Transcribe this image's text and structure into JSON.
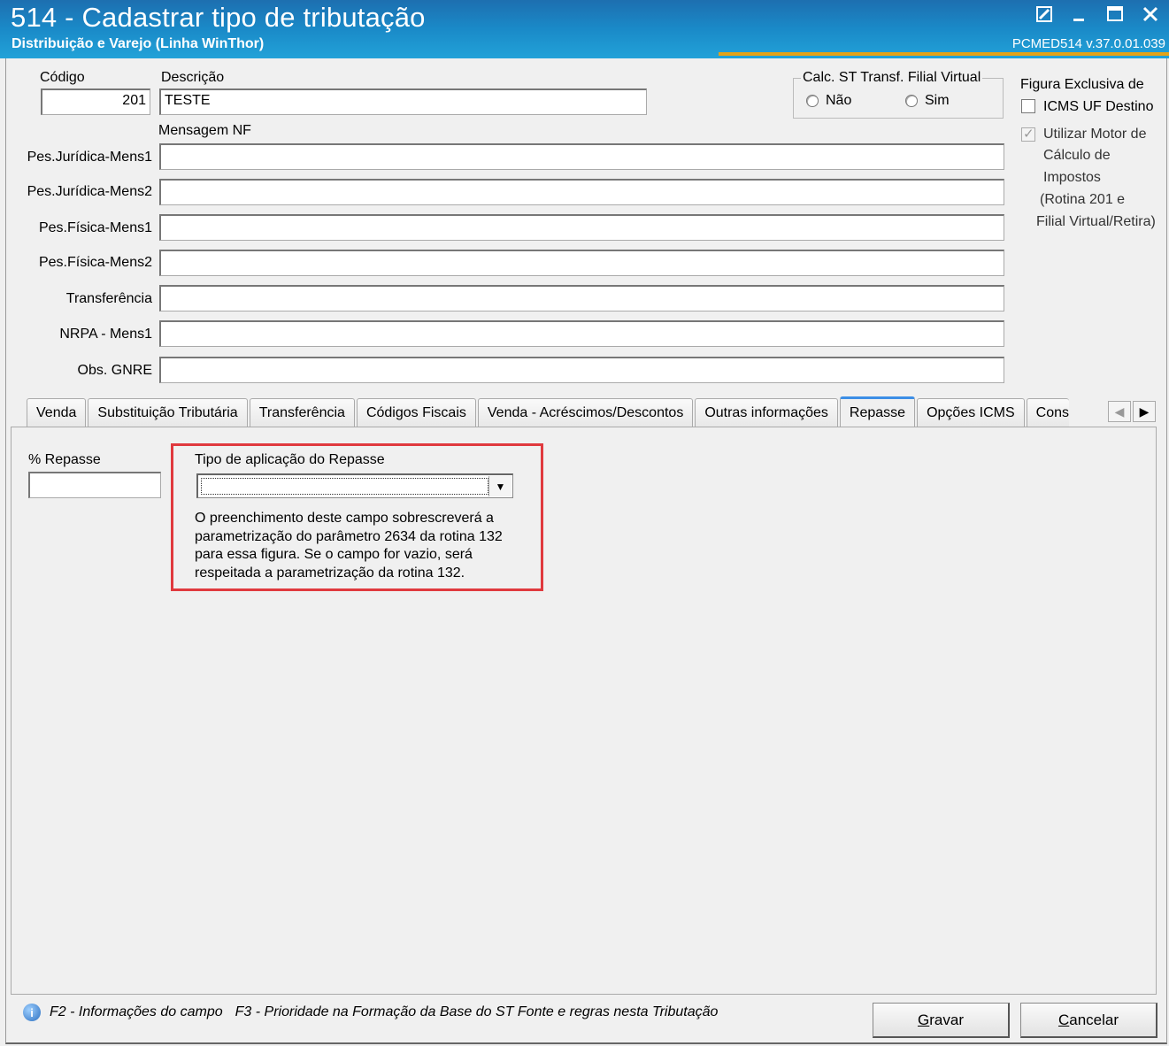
{
  "window": {
    "title": "514 - Cadastrar tipo de tributação",
    "subtitle": "Distribuição e Varejo (Linha WinThor)",
    "version": "PCMED514  v.37.0.01.039"
  },
  "form": {
    "codigo_label": "Código",
    "codigo_value": "201",
    "descricao_label": "Descrição",
    "descricao_value": "TESTE",
    "mensagem_nf_label": "Mensagem NF",
    "rows": [
      {
        "label": "Pes.Jurídica-Mens1",
        "value": ""
      },
      {
        "label": "Pes.Jurídica-Mens2",
        "value": ""
      },
      {
        "label": "Pes.Física-Mens1",
        "value": ""
      },
      {
        "label": "Pes.Física-Mens2",
        "value": ""
      },
      {
        "label": "Transferência",
        "value": ""
      },
      {
        "label": "NRPA - Mens1",
        "value": ""
      },
      {
        "label": "Obs. GNRE",
        "value": ""
      }
    ]
  },
  "calc_st": {
    "title": "Calc. ST Transf. Filial Virtual",
    "option_nao": "Não",
    "option_sim": "Sim"
  },
  "figura": {
    "title": "Figura Exclusiva de",
    "icms_label": "ICMS UF Destino",
    "motor_lines": [
      "Utilizar Motor de",
      "Cálculo de",
      "Impostos",
      "(Rotina 201 e",
      "Filial Virtual/Retira)"
    ]
  },
  "tabs": [
    "Venda",
    "Substituição Tributária",
    "Transferência",
    "Códigos Fiscais",
    "Venda - Acréscimos/Descontos",
    "Outras informações",
    "Repasse",
    "Opções ICMS",
    "Cons"
  ],
  "repasse": {
    "percent_label": "% Repasse",
    "percent_value": "",
    "tipo_label": "Tipo de aplicação do Repasse",
    "tipo_value": "",
    "note_lines": [
      "O preenchimento deste campo sobrescreverá a",
      "parametrização do parâmetro 2634 da rotina 132",
      "para essa figura. Se o campo for vazio, será",
      "respeitada a parametrização da rotina 132."
    ]
  },
  "footer": {
    "f2": "F2 - Informações do campo",
    "f3": "F3 - Prioridade na Formação da Base do ST Fonte e regras nesta Tributação",
    "gravar_first": "G",
    "gravar_rest": "ravar",
    "cancelar_first": "C",
    "cancelar_rest": "ancelar"
  },
  "colors": {
    "title_bar": "#1a8ac8",
    "accent_bar": "#e4a318",
    "highlight_box": "#e0393e",
    "active_tab": "#3c8ee6"
  }
}
